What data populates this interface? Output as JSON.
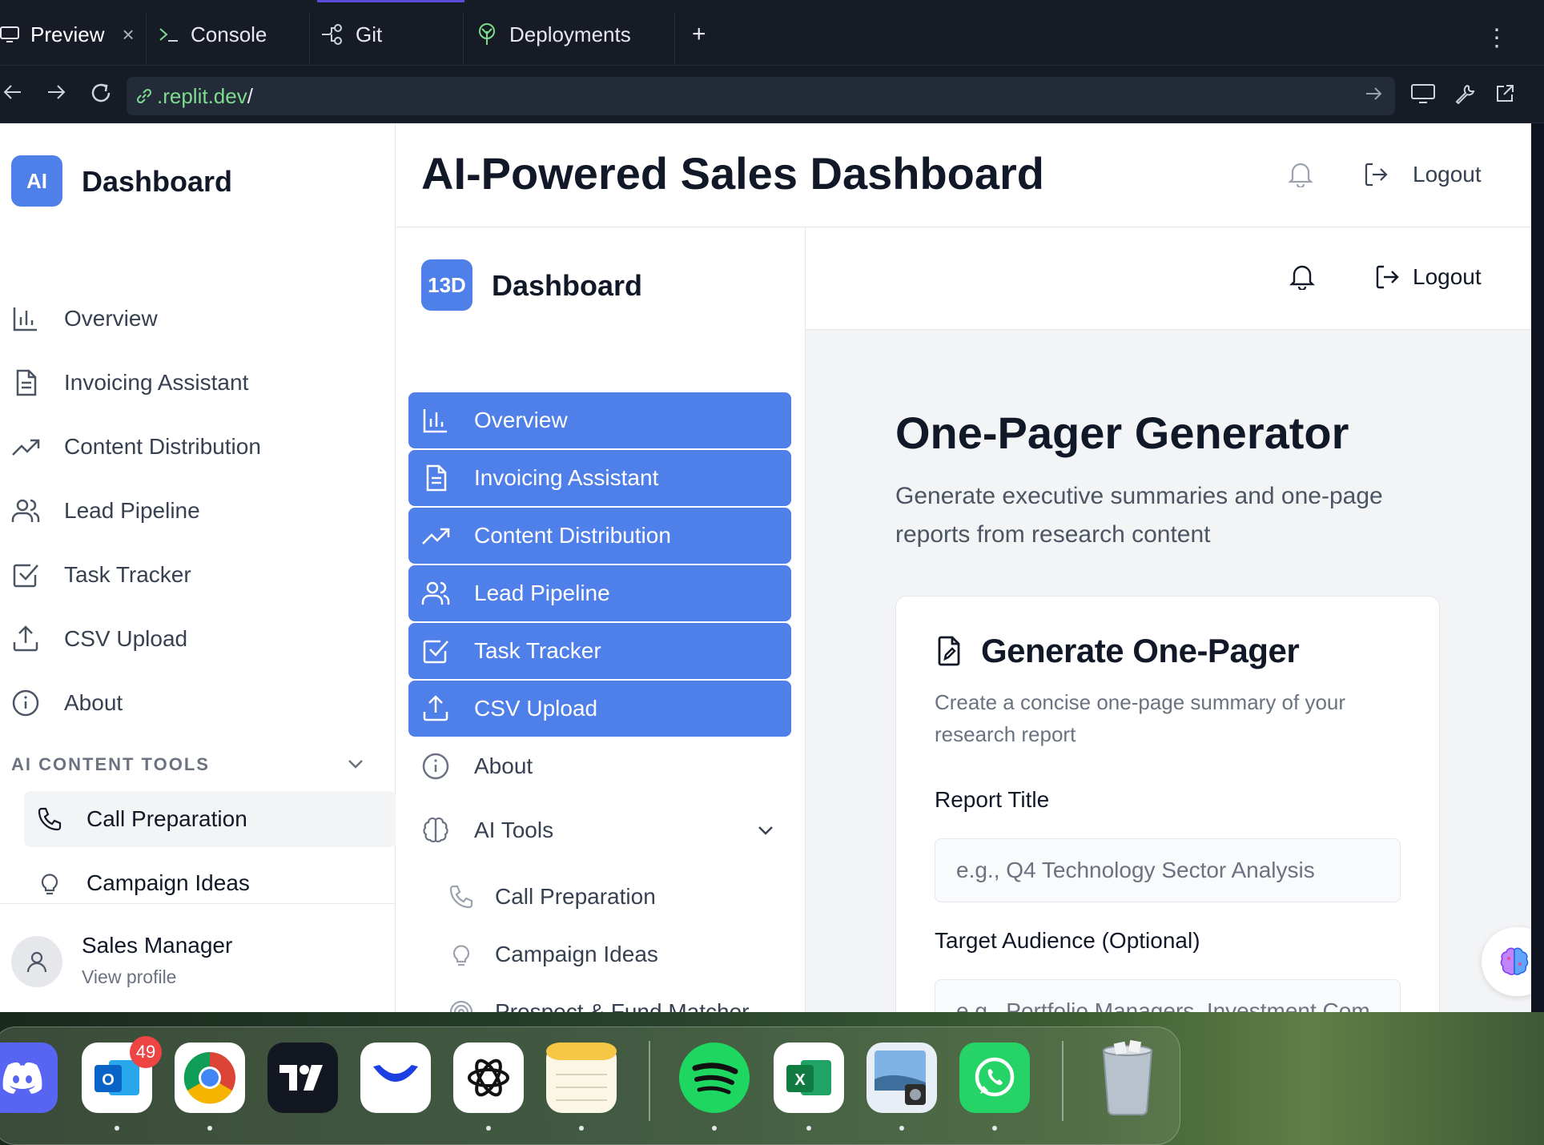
{
  "ide": {
    "tabs": [
      {
        "label": "Preview",
        "icon": "monitor-icon"
      },
      {
        "label": "Console",
        "icon": "terminal-icon"
      },
      {
        "label": "Git",
        "icon": "git-branch-icon"
      },
      {
        "label": "Deployments",
        "icon": "deployments-icon"
      }
    ],
    "new_tab": "+",
    "close_glyph": "×",
    "kebab": "⋮",
    "url_host": ".replit.dev",
    "url_path": "/"
  },
  "outer": {
    "logo": "AI",
    "brand": "Dashboard",
    "nav": [
      {
        "label": "Overview",
        "icon": "bar-chart-icon"
      },
      {
        "label": "Invoicing Assistant",
        "icon": "document-icon"
      },
      {
        "label": "Content Distribution",
        "icon": "trending-up-icon"
      },
      {
        "label": "Lead Pipeline",
        "icon": "users-icon"
      },
      {
        "label": "Task Tracker",
        "icon": "check-square-icon"
      },
      {
        "label": "CSV Upload",
        "icon": "upload-icon"
      },
      {
        "label": "About",
        "icon": "info-icon"
      }
    ],
    "section_heading": "AI CONTENT TOOLS",
    "sub_items": [
      {
        "label": "Call Preparation",
        "icon": "phone-icon"
      },
      {
        "label": "Campaign Ideas",
        "icon": "lightbulb-icon"
      }
    ],
    "user": {
      "name": "Sales Manager",
      "sub": "View profile"
    },
    "header_title": "AI-Powered Sales Dashboard",
    "logout": "Logout"
  },
  "inner": {
    "logo": "13D",
    "brand": "Dashboard",
    "nav_active": [
      {
        "label": "Overview",
        "icon": "bar-chart-icon"
      },
      {
        "label": "Invoicing Assistant",
        "icon": "document-icon"
      },
      {
        "label": "Content Distribution",
        "icon": "trending-up-icon"
      },
      {
        "label": "Lead Pipeline",
        "icon": "users-icon"
      },
      {
        "label": "Task Tracker",
        "icon": "check-square-icon"
      },
      {
        "label": "CSV Upload",
        "icon": "upload-icon"
      }
    ],
    "about": "About",
    "ai_tools": "AI Tools",
    "sub_items": [
      {
        "label": "Call Preparation",
        "icon": "phone-icon"
      },
      {
        "label": "Campaign Ideas",
        "icon": "lightbulb-icon"
      },
      {
        "label": "Prospect & Fund Matcher",
        "icon": "target-icon"
      }
    ],
    "logout": "Logout"
  },
  "page": {
    "title": "One-Pager Generator",
    "description": "Generate executive summaries and one-page reports from research content",
    "card": {
      "title": "Generate One-Pager",
      "description": "Create a concise one-page summary of your research report",
      "report_title_label": "Report Title",
      "report_title_placeholder": "e.g., Q4 Technology Sector Analysis",
      "audience_label": "Target Audience (Optional)",
      "audience_placeholder": "e.g., Portfolio Managers, Investment Com"
    }
  },
  "dock": {
    "outlook_badge": "49",
    "apps": [
      "Discord",
      "Outlook",
      "Chrome",
      "TradingView",
      "Quick Launch",
      "ChatGPT",
      "Notes",
      "Spotify",
      "Excel",
      "Preview",
      "WhatsApp",
      "Trash"
    ]
  },
  "colors": {
    "accent": "#4f7fe8",
    "ide_bg": "#161b26",
    "url_green": "#7ddc8d",
    "page_bg": "#f3f4f6"
  }
}
